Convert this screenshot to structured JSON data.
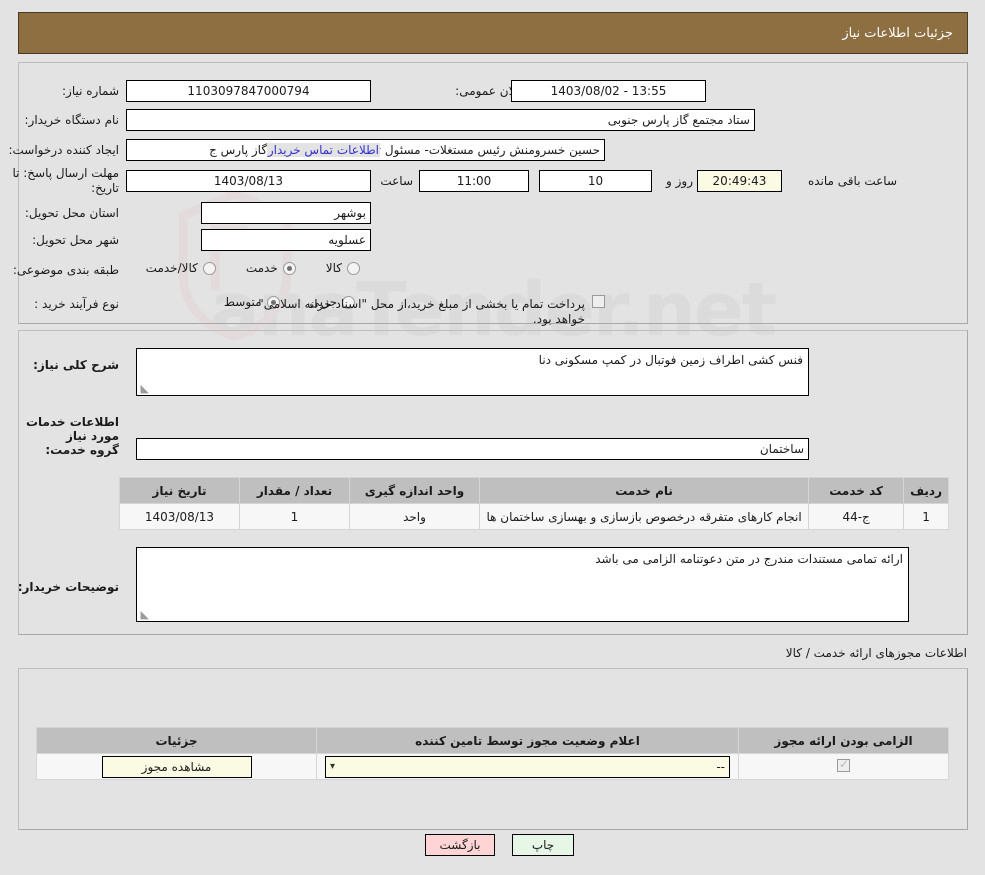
{
  "header": {
    "title": "جزئیات اطلاعات نیاز"
  },
  "top": {
    "labels": {
      "need_number": "شماره نیاز:",
      "buyer_org": "نام دستگاه خریدار:",
      "creator": "ایجاد کننده درخواست:",
      "deadline": "مهلت ارسال پاسخ: تا تاریخ:",
      "province": "استان محل تحویل:",
      "city": "شهر محل تحویل:",
      "category": "طبقه بندی موضوعی:",
      "process_type": "نوع فرآیند خرید :",
      "announce_datetime": "تاریخ و ساعت اعلان عمومی:",
      "hour": "ساعت",
      "day_and": "روز و",
      "hours_left": "ساعت باقی مانده"
    },
    "values": {
      "need_number": "1103097847000794",
      "buyer_org": "ستاد مجتمع گاز پارس جنوبی",
      "creator": "حسین خسرومنش رئیس مستغلات- مسئول تنخواه دار  ستاد مجتمع گاز پارس ج",
      "deadline_date": "1403/08/13",
      "deadline_hour": "11:00",
      "days_left": "10",
      "countdown": "20:49:43",
      "announce_datetime": "1403/08/02 - 13:55",
      "province": "بوشهر",
      "city": "عسلویه"
    },
    "buyer_contact_link": "اطلاعات تماس خریدار",
    "category_options": [
      {
        "label": "کالا",
        "selected": false
      },
      {
        "label": "خدمت",
        "selected": true
      },
      {
        "label": "کالا/خدمت",
        "selected": false
      }
    ],
    "process_options": [
      {
        "label": "جزیی",
        "selected": false
      },
      {
        "label": "متوسط",
        "selected": true
      }
    ],
    "treasury_checkbox": {
      "label": "پرداخت تمام یا بخشی از مبلغ خرید،از محل \"اسناد خزانه اسلامی\" خواهد بود.",
      "checked": false
    }
  },
  "mid": {
    "need_desc_label": "شرح کلی نیاز:",
    "need_desc_value": "فنس کشی اطراف زمین فوتبال در کمپ مسکونی دنا",
    "services_heading": "اطلاعات خدمات مورد نیاز",
    "service_group_label": "گروه خدمت:",
    "service_group_value": "ساختمان",
    "buyer_notes_label": "توضیحات خریدار:",
    "buyer_notes_value": "ارائه تمامی مستندات مندرج در متن دعوتنامه الزامی می باشد",
    "table": {
      "headers": [
        "ردیف",
        "کد خدمت",
        "نام خدمت",
        "واحد اندازه گیری",
        "تعداد / مقدار",
        "تاریخ نیاز"
      ],
      "rows": [
        [
          "1",
          "ج-44",
          "انجام کارهای متفرقه درخصوص بازسازی و بهسازی ساختمان ها",
          "واحد",
          "1",
          "1403/08/13"
        ]
      ]
    }
  },
  "licenses": {
    "heading": "اطلاعات مجوزهای ارائه خدمت / کالا",
    "table": {
      "headers": [
        "الزامی بودن ارائه مجوز",
        "اعلام وضعیت مجوز توسط تامین کننده",
        "جزئیات"
      ],
      "rows": [
        {
          "required": true,
          "status_value": "--",
          "details_button": "مشاهده مجوز"
        }
      ]
    }
  },
  "footer": {
    "back_label": "بازگشت",
    "print_label": "چاپ"
  },
  "watermark": {
    "text": "anaTender.net"
  },
  "colors": {
    "header_brown": "#8d6f42",
    "link_blue": "#3333cc",
    "back_btn": "#ffd4d4",
    "print_btn": "#e7f7e7",
    "field_ivory": "#fbfbe4",
    "table_header": "#bfbfbf"
  }
}
